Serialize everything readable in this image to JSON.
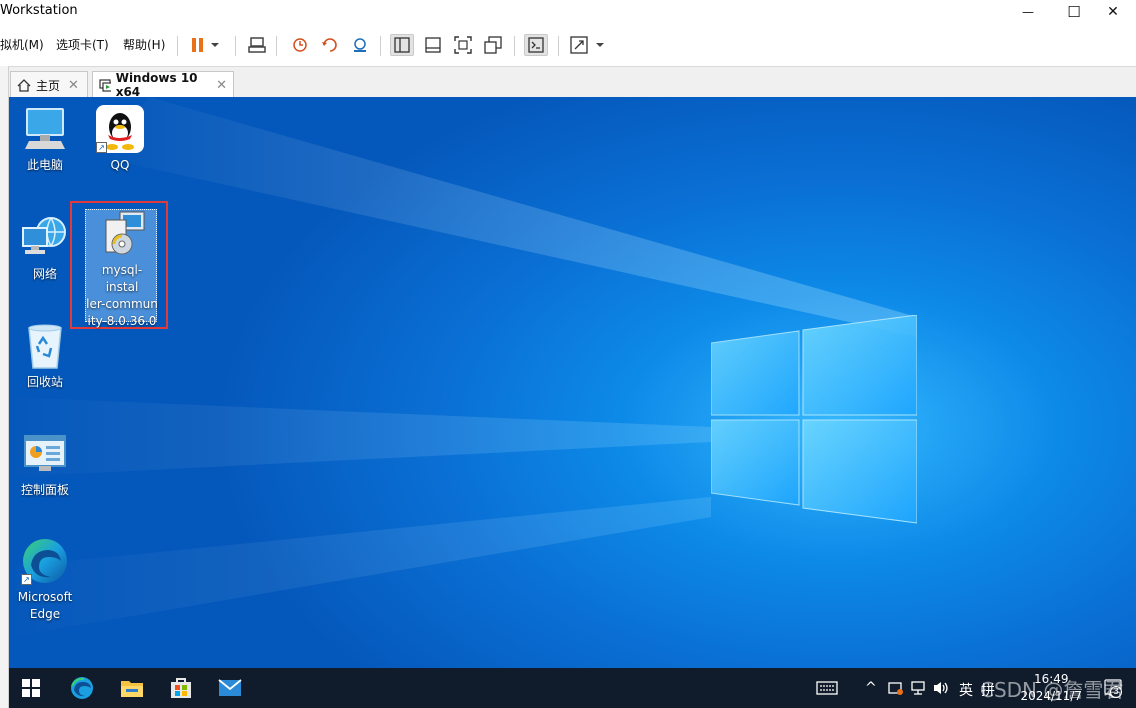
{
  "window": {
    "title": "Workstation",
    "minimize_glyph": "—",
    "maximize_glyph": "☐",
    "close_glyph": "✕"
  },
  "menu": {
    "items": [
      "虚拟机(M)",
      "选项卡(T)",
      "帮助(H)"
    ]
  },
  "toolbar": {
    "icons": [
      "pause-icon",
      "dropdown-arrow-icon",
      "send-ctrl-alt-del-icon",
      "snapshot-icon",
      "revert-snapshot-icon",
      "snapshot-manager-icon",
      "library-view-icon",
      "thumbnail-bar-icon",
      "fullscreen-icon",
      "unity-icon",
      "console-view-icon",
      "stretch-guest-icon"
    ]
  },
  "tabs": [
    {
      "label": "主页",
      "icon": "home-icon",
      "close": "✕",
      "active": false
    },
    {
      "label": "Windows 10 x64",
      "icon": "vm-icon",
      "close": "✕",
      "active": true
    }
  ],
  "desktop": {
    "icons": [
      {
        "label": "此电脑",
        "icon": "this-pc-icon"
      },
      {
        "label": "QQ",
        "icon": "qq-icon"
      },
      {
        "label": "网络",
        "icon": "network-icon"
      },
      {
        "label": "mysql-installer-community-8.0.36.0",
        "display": [
          "mysql-instal",
          "ler-commun",
          "ity-8.0.36.0"
        ],
        "icon": "installer-icon",
        "selected": true
      },
      {
        "label": "回收站",
        "icon": "recycle-bin-icon"
      },
      {
        "label": "控制面板",
        "icon": "control-panel-icon"
      },
      {
        "label": "Microsoft Edge",
        "display": [
          "Microsoft",
          "Edge"
        ],
        "icon": "edge-icon"
      }
    ]
  },
  "taskbar": {
    "apps": [
      "start-icon",
      "edge-icon",
      "file-explorer-icon",
      "store-icon",
      "mail-icon"
    ],
    "tray": {
      "chevron": "^",
      "ime": "英",
      "ime_mode": "拼"
    },
    "clock": {
      "time": "16:49",
      "date": "2024/11/7"
    },
    "notification_count": "3"
  },
  "watermark": "CSDN @詹雪君",
  "colors": {
    "desktop_blue": "#0a6fd4",
    "taskbar": "#101c2c",
    "selection_outline": "#e03a3a",
    "pause_orange": "#e8711a"
  }
}
